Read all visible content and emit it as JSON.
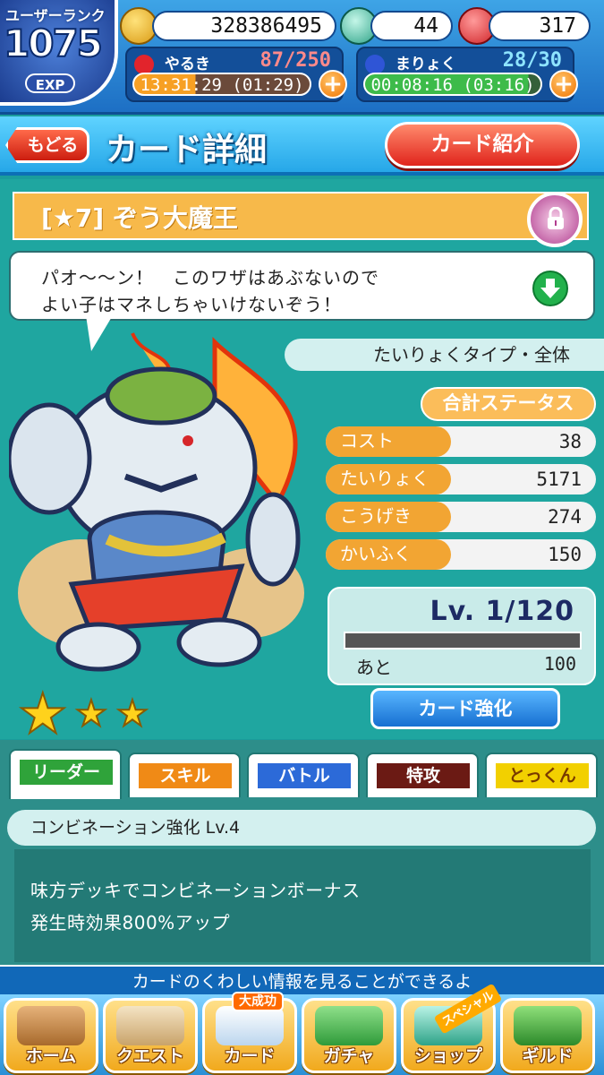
{
  "status": {
    "rank_label": "ユーザーランク",
    "rank_value": "1075",
    "exp_label": "EXP",
    "coins": "328386495",
    "gems": "44",
    "meat": "317",
    "stamina": {
      "label": "やるき",
      "value": "87/250",
      "timer": "13:31:29 (01:29)",
      "fill_fraction": 0.35
    },
    "magic": {
      "label": "まりょく",
      "value": "28/30",
      "timer": "00:08:16 (03:16)",
      "fill_fraction": 0.93
    },
    "plus_symbol": "+"
  },
  "header": {
    "back_label": "もどる",
    "title": "カード詳細",
    "intro_button": "カード紹介"
  },
  "card": {
    "name": "[★7] ぞう大魔王",
    "speech_line1": "パオ～～ン！　このワザはあぶないので",
    "speech_line2": "よい子はマネしちゃいけないぞう！",
    "type_label": "たいりょくタイプ・全体",
    "stats_header": "合計ステータス",
    "stats": [
      {
        "label": "コスト",
        "value": "38"
      },
      {
        "label": "たいりょく",
        "value": "5171"
      },
      {
        "label": "こうげき",
        "value": "274"
      },
      {
        "label": "かいふく",
        "value": "150"
      }
    ],
    "level_text": "Lv. 1/120",
    "level_fill_fraction": 0.0,
    "remain_label": "あと",
    "remain_value": "100",
    "enhance_button": "カード強化"
  },
  "tabs": [
    {
      "label": "リーダー",
      "color": "#2fa33a"
    },
    {
      "label": "スキル",
      "color": "#f08a16"
    },
    {
      "label": "バトル",
      "color": "#2c6ad8"
    },
    {
      "label": "特攻",
      "color": "#6b1a14"
    },
    {
      "label": "とっくん",
      "color": "#f2d000"
    }
  ],
  "skill": {
    "title": "コンビネーション強化 Lv.4",
    "line1": "味方デッキでコンビネーションボーナス",
    "line2": "発生時効果800%アップ"
  },
  "footer": {
    "hint": "カードのくわしい情報を見ることができるよ",
    "nav": [
      {
        "label": "ホーム"
      },
      {
        "label": "クエスト"
      },
      {
        "label": "カード",
        "badge": "大成功"
      },
      {
        "label": "ガチャ"
      },
      {
        "label": "ショップ",
        "badge": "スペシャル"
      },
      {
        "label": "ギルド"
      }
    ]
  },
  "colors": {
    "accent_orange": "#f2a533",
    "teal_bg": "#1fa6a0",
    "header_blue": "#26a7e8"
  }
}
